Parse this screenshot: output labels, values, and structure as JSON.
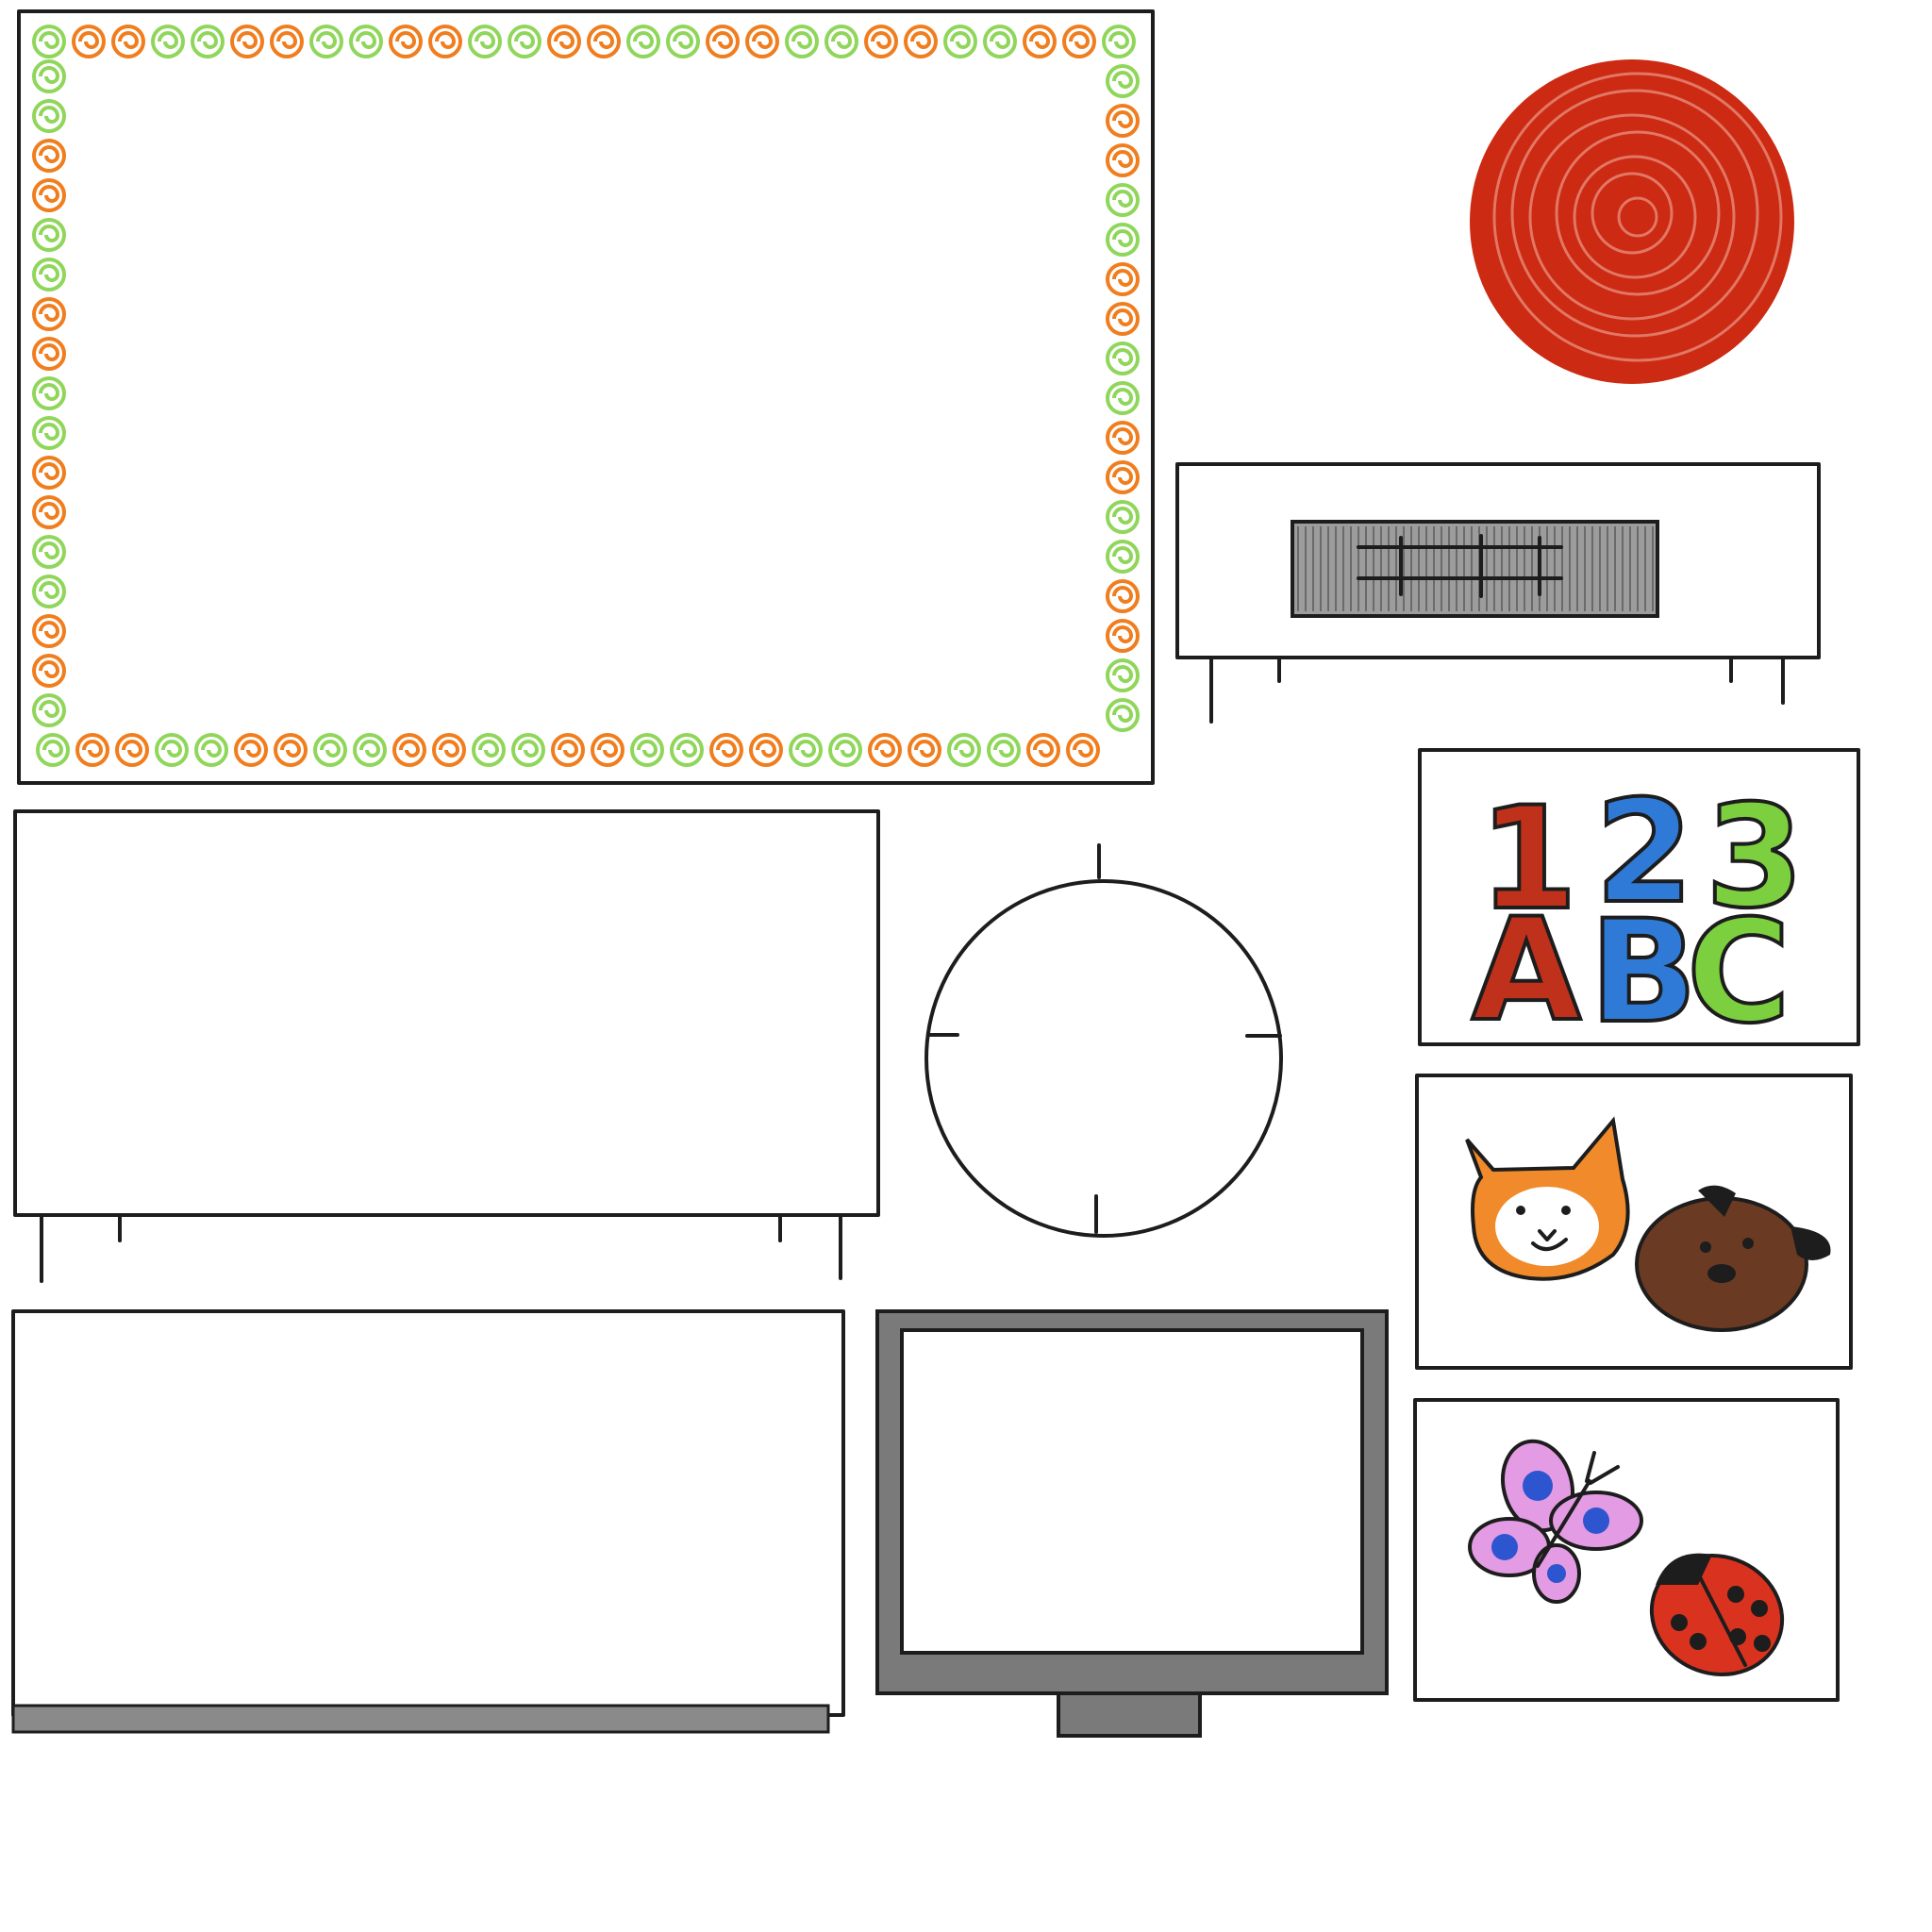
{
  "sheet": {
    "background": "#ffffff",
    "ink_color": "#1d1d1d"
  },
  "bulletin_board": {
    "border_colors": [
      "#8fd65a",
      "#f07d1e"
    ]
  },
  "red_rug": {
    "color": "#cc2a12"
  },
  "number_poster": {
    "digits": [
      "1",
      "2",
      "3"
    ],
    "letters": [
      "A",
      "B",
      "C"
    ],
    "colors": [
      "#c0311b",
      "#2f7ad6",
      "#7ccf3e"
    ]
  },
  "animal_poster": {
    "cat_color": "#f08a2a",
    "dog_color": "#6b3a22"
  },
  "insect_poster": {
    "butterfly_wing_color": "#e39be3",
    "butterfly_spot_color": "#2e55d0",
    "ladybug_color": "#d9331f"
  },
  "clock": {
    "tick_marks": 4
  },
  "screen": {
    "frame_color": "#7a7a7a"
  },
  "radiator": {
    "shade_color": "#8a8a8a"
  }
}
